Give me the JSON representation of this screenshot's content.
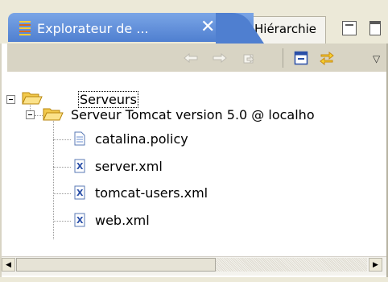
{
  "tabs": {
    "active_label": "Explorateur de ...",
    "close_glyph": "✕",
    "inactive_label": "Hiérarchie"
  },
  "toolbar": {
    "back_icon": "arrow-left-icon",
    "forward_icon": "arrow-right-icon",
    "home_icon": "home-icon",
    "collapse_icon": "collapse-all-icon",
    "link_icon": "link-with-editor-icon",
    "menu_icon": "view-menu-icon",
    "menu_glyph": "▽"
  },
  "tree": {
    "root": {
      "label": "Serveurs",
      "icon": "folder-open-icon",
      "expanded": true,
      "children": [
        {
          "label": "Serveur Tomcat version 5.0 @ localho",
          "icon": "folder-open-icon",
          "expanded": true,
          "children": [
            {
              "label": "catalina.policy",
              "icon": "file-icon"
            },
            {
              "label": "server.xml",
              "icon": "xml-file-icon"
            },
            {
              "label": "tomcat-users.xml",
              "icon": "xml-file-icon"
            },
            {
              "label": "web.xml",
              "icon": "xml-file-icon"
            }
          ]
        }
      ]
    }
  },
  "scrollbar": {
    "left_glyph": "◀",
    "right_glyph": "▶"
  },
  "colors": {
    "active_tab": "#5b8ad6",
    "toolbar_bg": "#d8d4c4",
    "folder": "#f2c94c"
  }
}
